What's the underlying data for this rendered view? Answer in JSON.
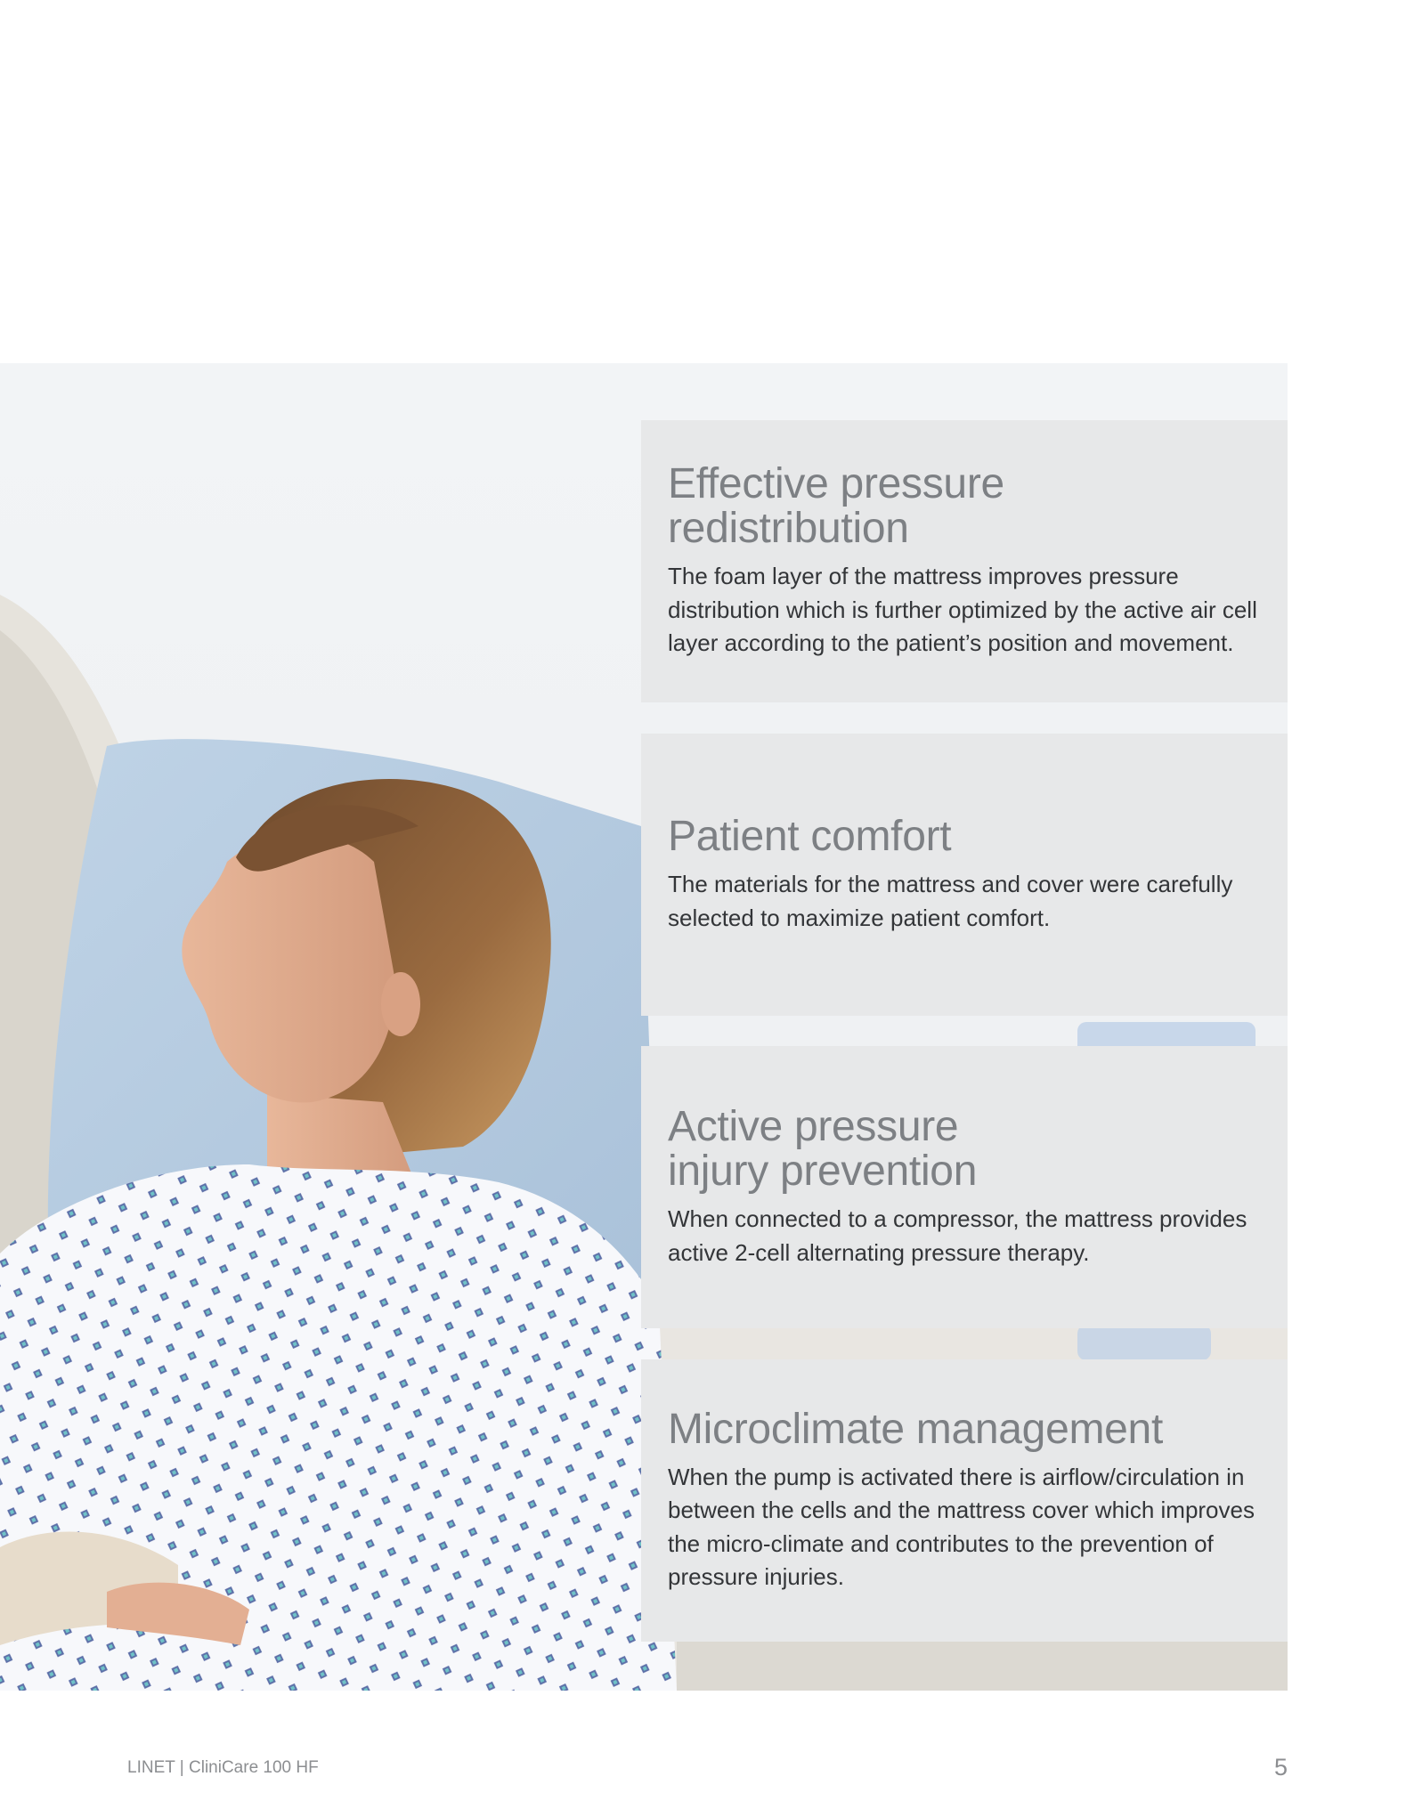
{
  "panels": [
    {
      "title_line1": "Effective pressure",
      "title_line2": "redistribution",
      "body": "The foam layer of the mattress improves pressure distribution which is further optimized by the active air cell layer according to the patient’s position and movement."
    },
    {
      "title_line1": "Patient comfort",
      "title_line2": "",
      "body": "The materials for the mattress and cover were carefully selected to maximize patient comfort."
    },
    {
      "title_line1": "Active pressure",
      "title_line2": "injury prevention",
      "body": "When connected to a compressor, the mattress provides active 2-cell alternating pressure therapy."
    },
    {
      "title_line1": "Microclimate management",
      "title_line2": "",
      "body": "When the pump is activated there is airflow/circulation in between the cells and the mattress cover which improves the micro-climate and contributes to the prevention of pressure injuries."
    }
  ],
  "footer": {
    "brand": "LINET | CliniCare 100 HF",
    "page_number": "5"
  },
  "colors": {
    "panel_background": "#e7e8e9",
    "title_gray": "#7d8084",
    "body_text": "#333538",
    "footer_gray": "#8c8e91"
  }
}
